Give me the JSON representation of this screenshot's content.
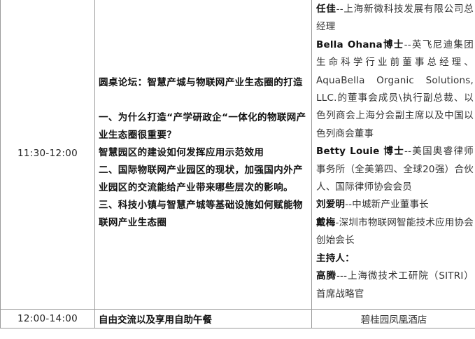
{
  "rows": [
    {
      "time": "11:30-12:00",
      "topic": {
        "title": "圆桌论坛：智慧产城与物联网产业生态圈的打造",
        "items": [
          "一、为什么打造“产学研政企“一体化的物联网产业生态圈很重要？",
          "智慧园区的建设如何发挥应用示范效用",
          "二、国际物联网产业园区的现状，加强国内外产业园区的交流能给产业带来哪些层次的影响。",
          "三、科技小镇与智慧产城等基础设施如何赋能物联网产业生态圈"
        ]
      },
      "guests": [
        {
          "name": "任佳",
          "sep": "--",
          "desc": "上海新微科技发展有限公司总经理"
        },
        {
          "name": "Bella Ohana博士",
          "sep": "--",
          "desc": "英飞尼迪集团生命科学行业前董事总经理、AquaBella Organic Solutions, LLC.的董事会成员\\执行副总裁、以色列商会上海分会副主席以及中国以色列商会董事"
        },
        {
          "name": "Betty Louie 博士",
          "sep": "--",
          "desc": "美国奥睿律师事务所（全美第四、全球20强）合伙人、国际律师协会会员"
        },
        {
          "name": "刘爱明",
          "sep": "--",
          "desc": "中城新产业董事长"
        },
        {
          "name": "戴梅",
          "sep": "-",
          "desc": "深圳市物联网智能技术应用协会创始会长"
        },
        {
          "name": "主持人：",
          "sep": "",
          "desc": ""
        },
        {
          "name": "高腾",
          "sep": "---",
          "desc": "上海微技术工研院（SITRI）首席战略官"
        }
      ]
    },
    {
      "time": "12:00-14:00",
      "topic_text": "自由交流以及享用自助午餐",
      "venue": "碧桂园凤凰酒店"
    }
  ]
}
